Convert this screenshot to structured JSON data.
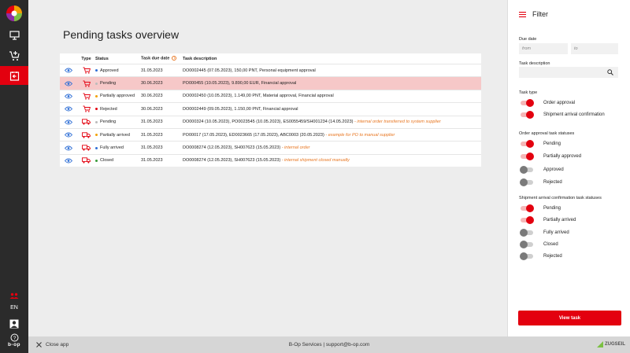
{
  "app": {
    "brand": "b-op",
    "lang": "EN"
  },
  "page": {
    "title": "Pending tasks overview"
  },
  "table": {
    "headers": {
      "type": "Type",
      "status": "Status",
      "due_date": "Task due date",
      "description": "Task description"
    },
    "rows": [
      {
        "type": "cart",
        "status": "Approved",
        "status_color": "#2f6fd6",
        "date": "31.05.2023",
        "desc": "DO0002445 (07.05.2023), 150,00 PNT, Personal equipment approval",
        "note": "",
        "highlight": false
      },
      {
        "type": "cart",
        "status": "Pending",
        "status_color": "#bbbbbb",
        "date": "30.06.2023",
        "desc": "PO000455 (10.05.2023), 9.890,00 EUR, Financial approval",
        "note": "",
        "highlight": true
      },
      {
        "type": "cart",
        "status": "Partially approved",
        "status_color": "#f2a100",
        "date": "30.06.2023",
        "desc": "DO0002450 (10.05.2023), 1.149,00 PNT, Material approval, Financial approval",
        "note": "",
        "highlight": false
      },
      {
        "type": "cart",
        "status": "Rejected",
        "status_color": "#e3000f",
        "date": "30.06.2023",
        "desc": "DO0002449 (09.05.2023), 1.150,00 PNT, Financial approval",
        "note": "",
        "highlight": false
      },
      {
        "type": "truck",
        "status": "Pending",
        "status_color": "#bbbbbb",
        "date": "31.05.2023",
        "desc": "DO000324 (10.05.2023), PO0023545 (10.05.2023), ES0055459/SH001234 (14.05.2023)",
        "note": "- internal order transferred to system supplier",
        "highlight": false
      },
      {
        "type": "truck",
        "status": "Partially arrived",
        "status_color": "#f2a100",
        "date": "31.05.2023",
        "desc": "PO00017 (17.05.2023), ED0023665 (17.05.2023), ABC0003 (20.05.2023)",
        "note": "- example for PO to manual supplier",
        "highlight": false
      },
      {
        "type": "truck",
        "status": "Fully arrived",
        "status_color": "#2f6fd6",
        "date": "31.05.2023",
        "desc": "DO0008274 (12.05.2023), SH007623 (15.05.2023)",
        "note": "- internal order",
        "highlight": false
      },
      {
        "type": "truck",
        "status": "Closed",
        "status_color": "#3a9a3a",
        "date": "31.05.2023",
        "desc": "DO0008274 (12.05.2023), SH007623 (15.05.2023)",
        "note": "- internal shipment closed manually",
        "highlight": false
      }
    ]
  },
  "filter": {
    "title": "Filter",
    "due_date_label": "Due date",
    "from_placeholder": "from",
    "to_placeholder": "to",
    "desc_label": "Task description",
    "task_type_label": "Task type",
    "task_types": [
      {
        "label": "Order approval",
        "on": true
      },
      {
        "label": "Shipment arrival confirmation",
        "on": true
      }
    ],
    "order_status_label": "Order approval task statuses",
    "order_statuses": [
      {
        "label": "Pending",
        "on": true
      },
      {
        "label": "Partially approved",
        "on": true
      },
      {
        "label": "Approved",
        "on": false
      },
      {
        "label": "Rejected",
        "on": false
      }
    ],
    "shipment_status_label": "Shipment arrival confirmation task statuses",
    "shipment_statuses": [
      {
        "label": "Pending",
        "on": true
      },
      {
        "label": "Partially arrived",
        "on": true
      },
      {
        "label": "Fully arrived",
        "on": false
      },
      {
        "label": "Closed",
        "on": false
      },
      {
        "label": "Rejected",
        "on": false
      }
    ],
    "view_button": "View task"
  },
  "footer": {
    "close_app": "Close app",
    "services": "B-Op Services | support@b-op.com",
    "vendor": "ZUGSEIL"
  },
  "colors": {
    "accent": "#e3000f",
    "icon_blue": "#2f6fd6",
    "note_orange": "#e87722"
  }
}
